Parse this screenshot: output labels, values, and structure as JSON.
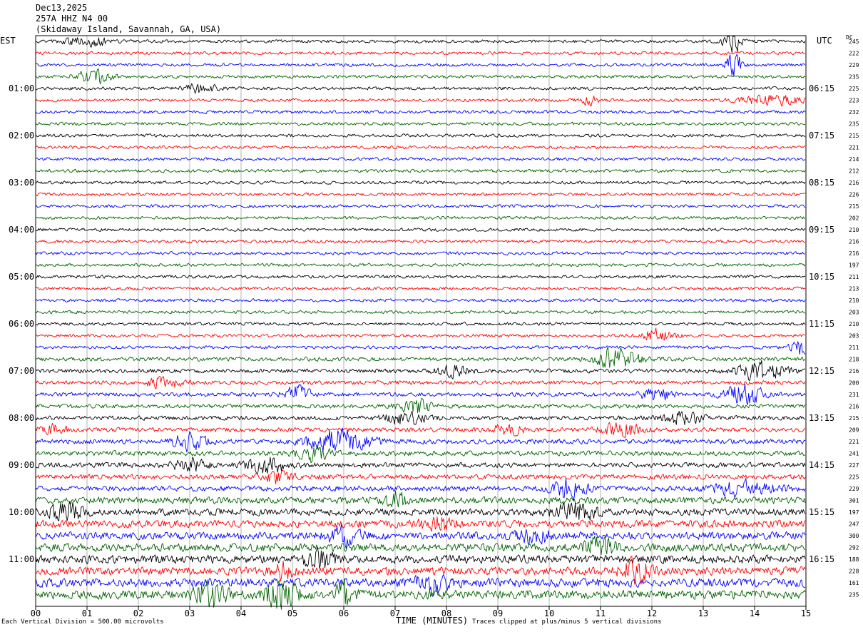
{
  "header": {
    "date": "Dec13,2025",
    "station": "257A HHZ N4 00",
    "location": "(Skidaway Island, Savannah, GA, USA)"
  },
  "timezones": {
    "left": "EST",
    "right": "UTC",
    "dc_heading": "DC"
  },
  "footer": {
    "scale_note": "Each Vertical Division =  500.00 microvolts",
    "clip_note": "Traces clipped at plus/minus 5 vertical divisions"
  },
  "colors": {
    "trace_cycle": [
      "#000000",
      "#ff0000",
      "#0000ff",
      "#006400"
    ],
    "grid": "#808080"
  },
  "chart_data": {
    "type": "line",
    "subtype": "helicorder",
    "xlabel": "TIME (MINUTES)",
    "xlim": [
      0,
      15
    ],
    "x_ticks": [
      "00",
      "01",
      "02",
      "03",
      "04",
      "05",
      "06",
      "07",
      "08",
      "09",
      "10",
      "11",
      "12",
      "13",
      "14",
      "15"
    ],
    "minutes_per_line": 15,
    "line_count": 48,
    "left_time_labels": [
      "01:00",
      "02:00",
      "03:00",
      "04:00",
      "05:00",
      "06:00",
      "07:00",
      "08:00",
      "09:00",
      "10:00",
      "11:00"
    ],
    "right_time_labels": [
      "06:15",
      "07:15",
      "08:15",
      "09:15",
      "10:15",
      "11:15",
      "12:15",
      "13:15",
      "14:15",
      "15:15",
      "16:15"
    ],
    "time_label_every_n_lines": 4,
    "time_label_first_line": 4,
    "dc_offsets": [
      245,
      222,
      229,
      235,
      225,
      223,
      232,
      235,
      215,
      221,
      214,
      212,
      216,
      226,
      215,
      202,
      210,
      216,
      216,
      197,
      211,
      213,
      210,
      203,
      210,
      203,
      211,
      218,
      216,
      200,
      231,
      216,
      215,
      209,
      221,
      241,
      227,
      225,
      229,
      301,
      197,
      247,
      300,
      292,
      188,
      228,
      161,
      235
    ],
    "activity_level": [
      1,
      1,
      1,
      1,
      1,
      1,
      1,
      1,
      1,
      1,
      1,
      1,
      1,
      1,
      1,
      1,
      1,
      1,
      1,
      1,
      1,
      1,
      1,
      1,
      1,
      1,
      1,
      1.3,
      1.3,
      1.3,
      1.3,
      1.3,
      1.4,
      1.4,
      1.5,
      1.6,
      1.6,
      1.6,
      1.7,
      2.2,
      2.2,
      2.4,
      2.4,
      2.6,
      2.6,
      2.6,
      2.8,
      2.8
    ],
    "events": [
      {
        "line": 0,
        "minute": 1.0,
        "amp": 9,
        "dur": 0.4
      },
      {
        "line": 0,
        "minute": 13.55,
        "amp": 26,
        "dur": 0.15
      },
      {
        "line": 2,
        "minute": 13.6,
        "amp": 20,
        "dur": 0.15
      },
      {
        "line": 3,
        "minute": 1.15,
        "amp": 14,
        "dur": 0.3
      },
      {
        "line": 4,
        "minute": 3.2,
        "amp": 10,
        "dur": 0.3
      },
      {
        "line": 5,
        "minute": 10.8,
        "amp": 10,
        "dur": 0.15
      },
      {
        "line": 5,
        "minute": 14.3,
        "amp": 8,
        "dur": 0.6
      },
      {
        "line": 25,
        "minute": 12.1,
        "amp": 11,
        "dur": 0.3
      },
      {
        "line": 26,
        "minute": 14.9,
        "amp": 13,
        "dur": 0.2
      },
      {
        "line": 27,
        "minute": 11.3,
        "amp": 18,
        "dur": 0.4
      },
      {
        "line": 28,
        "minute": 8.1,
        "amp": 10,
        "dur": 0.3
      },
      {
        "line": 28,
        "minute": 14.1,
        "amp": 14,
        "dur": 0.5
      },
      {
        "line": 29,
        "minute": 2.5,
        "amp": 10,
        "dur": 0.3
      },
      {
        "line": 30,
        "minute": 5.1,
        "amp": 13,
        "dur": 0.25
      },
      {
        "line": 30,
        "minute": 12.1,
        "amp": 10,
        "dur": 0.3
      },
      {
        "line": 30,
        "minute": 13.8,
        "amp": 15,
        "dur": 0.4
      },
      {
        "line": 31,
        "minute": 7.4,
        "amp": 12,
        "dur": 0.3
      },
      {
        "line": 32,
        "minute": 7.2,
        "amp": 10,
        "dur": 0.4
      },
      {
        "line": 32,
        "minute": 12.6,
        "amp": 9,
        "dur": 0.4
      },
      {
        "line": 33,
        "minute": 0.3,
        "amp": 8,
        "dur": 0.3
      },
      {
        "line": 33,
        "minute": 9.2,
        "amp": 9,
        "dur": 0.3
      },
      {
        "line": 33,
        "minute": 11.4,
        "amp": 11,
        "dur": 0.4
      },
      {
        "line": 34,
        "minute": 3.0,
        "amp": 14,
        "dur": 0.3
      },
      {
        "line": 34,
        "minute": 5.9,
        "amp": 18,
        "dur": 0.6
      },
      {
        "line": 35,
        "minute": 5.4,
        "amp": 12,
        "dur": 0.3
      },
      {
        "line": 36,
        "minute": 3.0,
        "amp": 12,
        "dur": 0.3
      },
      {
        "line": 36,
        "minute": 4.5,
        "amp": 12,
        "dur": 0.4
      },
      {
        "line": 37,
        "minute": 4.7,
        "amp": 10,
        "dur": 0.3
      },
      {
        "line": 38,
        "minute": 10.4,
        "amp": 16,
        "dur": 0.3
      },
      {
        "line": 38,
        "minute": 13.8,
        "amp": 12,
        "dur": 0.6
      },
      {
        "line": 39,
        "minute": 7.0,
        "amp": 14,
        "dur": 0.2
      },
      {
        "line": 40,
        "minute": 0.6,
        "amp": 14,
        "dur": 0.3
      },
      {
        "line": 40,
        "minute": 10.5,
        "amp": 14,
        "dur": 0.4
      },
      {
        "line": 41,
        "minute": 7.8,
        "amp": 10,
        "dur": 0.3
      },
      {
        "line": 42,
        "minute": 6.0,
        "amp": 14,
        "dur": 0.3
      },
      {
        "line": 42,
        "minute": 9.7,
        "amp": 12,
        "dur": 0.3
      },
      {
        "line": 43,
        "minute": 11.0,
        "amp": 14,
        "dur": 0.3
      },
      {
        "line": 44,
        "minute": 5.5,
        "amp": 14,
        "dur": 0.3
      },
      {
        "line": 45,
        "minute": 4.8,
        "amp": 14,
        "dur": 0.2
      },
      {
        "line": 45,
        "minute": 11.7,
        "amp": 18,
        "dur": 0.3
      },
      {
        "line": 46,
        "minute": 7.7,
        "amp": 14,
        "dur": 0.3
      },
      {
        "line": 47,
        "minute": 3.4,
        "amp": 22,
        "dur": 0.3
      },
      {
        "line": 47,
        "minute": 4.8,
        "amp": 22,
        "dur": 0.3
      },
      {
        "line": 47,
        "minute": 6.0,
        "amp": 20,
        "dur": 0.2
      }
    ]
  }
}
